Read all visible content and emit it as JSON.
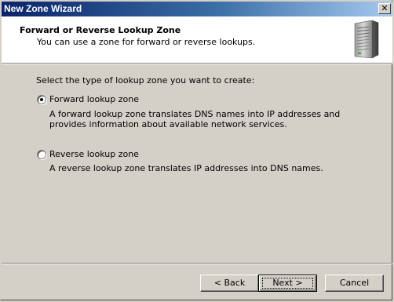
{
  "window": {
    "title": "New Zone Wizard",
    "close_glyph": "✕"
  },
  "header": {
    "title": "Forward or Reverse Lookup Zone",
    "subtitle": "You can use a zone for forward or reverse lookups.",
    "icon": "server-icon"
  },
  "body": {
    "prompt": "Select the type of lookup zone you want to create:",
    "options": [
      {
        "label": "Forward lookup zone",
        "selected": true,
        "description": "A forward lookup zone translates DNS names into IP addresses and provides information about available network services."
      },
      {
        "label": "Reverse lookup zone",
        "selected": false,
        "description": "A reverse lookup zone translates IP addresses into DNS names."
      }
    ]
  },
  "buttons": {
    "back": "< Back",
    "next": "Next >",
    "cancel": "Cancel"
  }
}
